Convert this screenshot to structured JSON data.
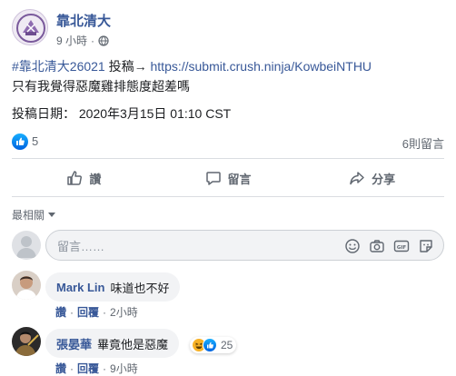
{
  "post": {
    "page_name": "靠北清大",
    "time": "9 小時",
    "dot": "·",
    "privacy_icon": "globe-icon",
    "hashtag": "#靠北清大26021",
    "submit_text": " 投稿→ ",
    "link": "https://submit.crush.ninja/KowbeiNTHU",
    "line2": "只有我覺得惡魔雞排態度超差嗎",
    "line3": "投稿日期： 2020年3月15日 01:10 CST"
  },
  "reactions": {
    "like_count": "5",
    "comment_count": "6則留言"
  },
  "actions": {
    "like_label": "讚",
    "comment_label": "留言",
    "share_label": "分享"
  },
  "sort": {
    "label": "最相關"
  },
  "composer": {
    "placeholder": "留言……"
  },
  "comments": [
    {
      "author": "Mark Lin",
      "text": "味道也不好",
      "like_label": "讚",
      "reply_label": "回覆",
      "time": "2小時"
    },
    {
      "author": "張晏華",
      "text": "畢竟他是惡魔",
      "like_label": "讚",
      "reply_label": "回覆",
      "time": "9小時",
      "reaction_count": "25"
    }
  ],
  "colors": {
    "link": "#385898",
    "muted": "#606770",
    "bubble": "#f2f3f5",
    "like_blue": "#1877f2"
  }
}
